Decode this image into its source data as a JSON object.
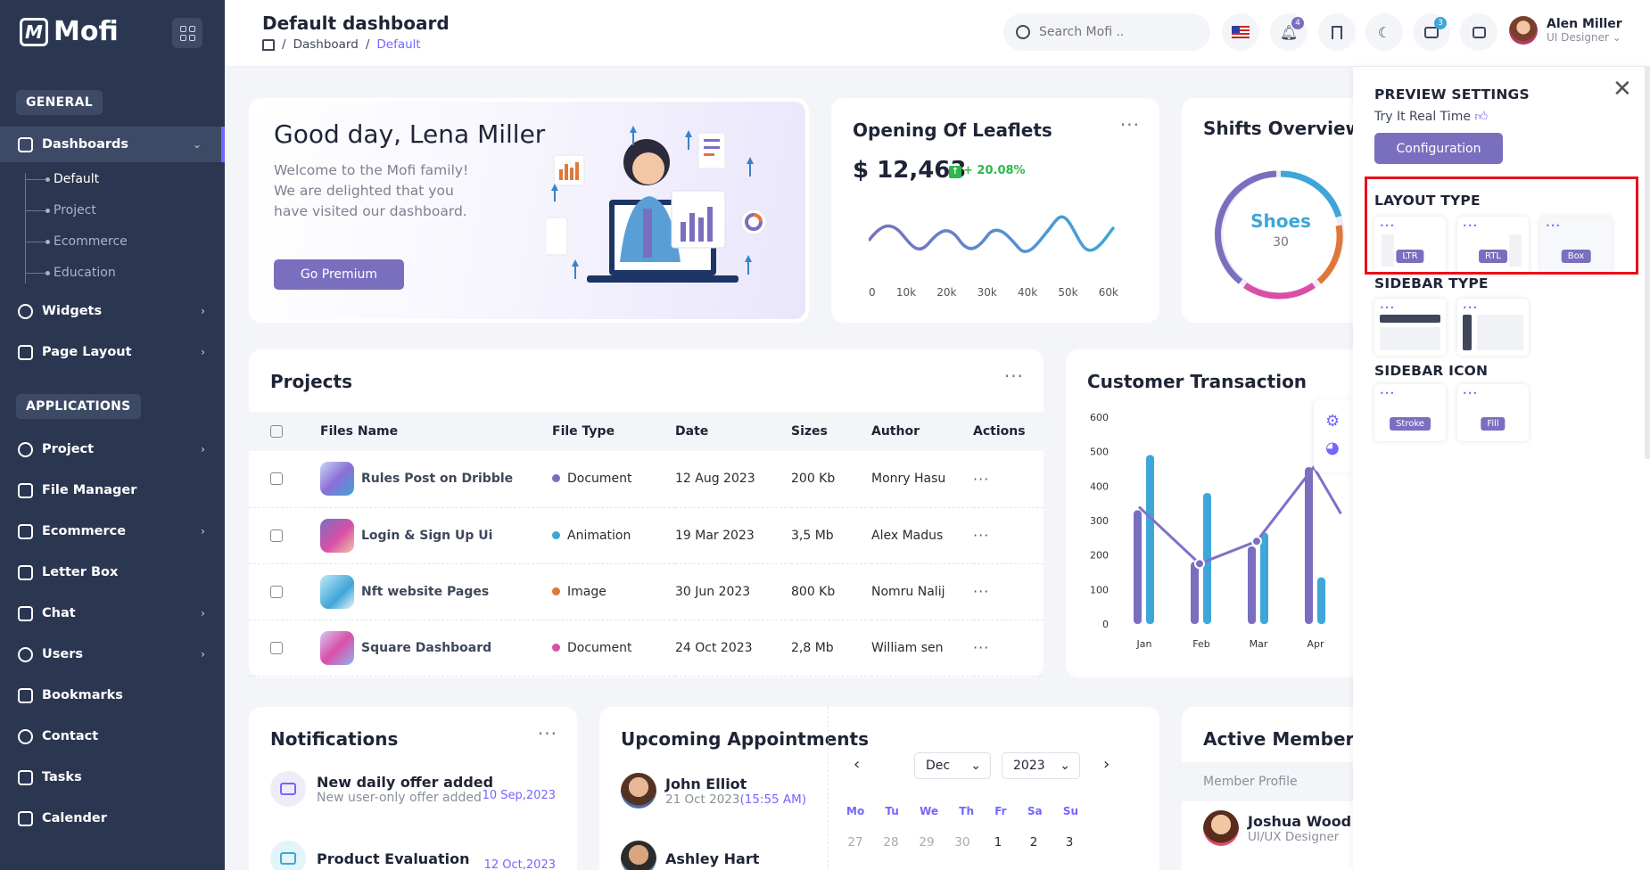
{
  "brand": {
    "name": "Mofi",
    "accent": "#7366ff",
    "sidebar_bg": "#2b3751"
  },
  "sidebar": {
    "general_label": "GENERAL",
    "applications_label": "APPLICATIONS",
    "dashboards": {
      "label": "Dashboards",
      "items": [
        "Default",
        "Project",
        "Ecommerce",
        "Education"
      ]
    },
    "widgets": "Widgets",
    "page_layout": "Page Layout",
    "apps": [
      "Project",
      "File Manager",
      "Ecommerce",
      "Letter Box",
      "Chat",
      "Users",
      "Bookmarks",
      "Contact",
      "Tasks",
      "Calender"
    ]
  },
  "header": {
    "title": "Default dashboard",
    "breadcrumb": [
      "Dashboard",
      "Default"
    ],
    "search_placeholder": "Search Mofi ..",
    "notif_count": "4",
    "cart_count": "3",
    "user_name": "Alen Miller",
    "user_role": "UI Designer"
  },
  "welcome": {
    "greeting": "Good day, Lena Miller",
    "message": "Welcome to the Mofi family! We are delighted that you have visited our dashboard.",
    "button": "Go Premium"
  },
  "leaflets": {
    "title": "Opening Of Leaflets",
    "amount": "$ 12,463",
    "growth": "+ 20.08%",
    "x_ticks": [
      "0",
      "10k",
      "20k",
      "30k",
      "40k",
      "50k",
      "60k"
    ]
  },
  "shifts": {
    "title": "Shifts Overview",
    "center_label": "Shoes",
    "center_value": "30"
  },
  "projects": {
    "title": "Projects",
    "columns": [
      "Files Name",
      "File Type",
      "Date",
      "Sizes",
      "Author",
      "Actions"
    ],
    "rows": [
      {
        "name": "Rules Post on Dribble",
        "type": "Document",
        "type_color": "#7a6fbf",
        "date": "12 Aug 2023",
        "size": "200 Kb",
        "author": "Monry Hasu"
      },
      {
        "name": "Login & Sign Up Ui",
        "type": "Animation",
        "type_color": "#3ea6d8",
        "date": "19 Mar 2023",
        "size": "3,5 Mb",
        "author": "Alex Madus"
      },
      {
        "name": "Nft website Pages",
        "type": "Image",
        "type_color": "#e0773a",
        "date": "30 Jun 2023",
        "size": "800 Kb",
        "author": "Nomru Nalij"
      },
      {
        "name": "Square Dashboard",
        "type": "Document",
        "type_color": "#d94fa8",
        "date": "24 Oct 2023",
        "size": "2,8 Mb",
        "author": "William sen"
      }
    ]
  },
  "customer": {
    "title": "Customer Transaction"
  },
  "chart_data": {
    "type": "bar",
    "categories": [
      "Jan",
      "Feb",
      "Mar",
      "Apr"
    ],
    "series": [
      {
        "values": [
          330,
          180,
          225,
          455
        ]
      },
      {
        "values": [
          490,
          380,
          265,
          135
        ]
      },
      {
        "values": [
          340,
          175,
          240,
          455
        ]
      }
    ],
    "ylim": [
      0,
      600
    ],
    "yticks": [
      "0",
      "100",
      "200",
      "300",
      "400",
      "500",
      "600"
    ]
  },
  "notifications": {
    "title": "Notifications",
    "items": [
      {
        "title": "New daily offer added",
        "sub": "New user-only offer added",
        "date": "10 Sep,2023"
      },
      {
        "title": "Product Evaluation",
        "date": "12 Oct,2023"
      }
    ]
  },
  "appointments": {
    "title": "Upcoming Appointments",
    "items": [
      {
        "name": "John Elliot",
        "date": "21 Oct 2023",
        "time": "(15:55 AM)"
      },
      {
        "name": "Ashley Hart"
      }
    ],
    "calendar": {
      "month": "Dec",
      "year": "2023",
      "dow": [
        "Mo",
        "Tu",
        "We",
        "Th",
        "Fr",
        "Sa",
        "Su"
      ],
      "days": [
        "27",
        "28",
        "29",
        "30",
        "1",
        "2",
        "3"
      ]
    }
  },
  "members": {
    "title": "Active Members",
    "header": "Member Profile",
    "items": [
      {
        "name": "Joshua Wood",
        "role": "UI/UX Designer"
      }
    ]
  },
  "preview": {
    "title": "PREVIEW SETTINGS",
    "subtitle": "Try It Real Time",
    "config_button": "Configuration",
    "layout_type": "LAYOUT TYPE",
    "layout_options": [
      "LTR",
      "RTL",
      "Box"
    ],
    "sidebar_type": "SIDEBAR TYPE",
    "sidebar_icon": "SIDEBAR ICON",
    "icon_options": [
      "Stroke",
      "Fill"
    ]
  }
}
